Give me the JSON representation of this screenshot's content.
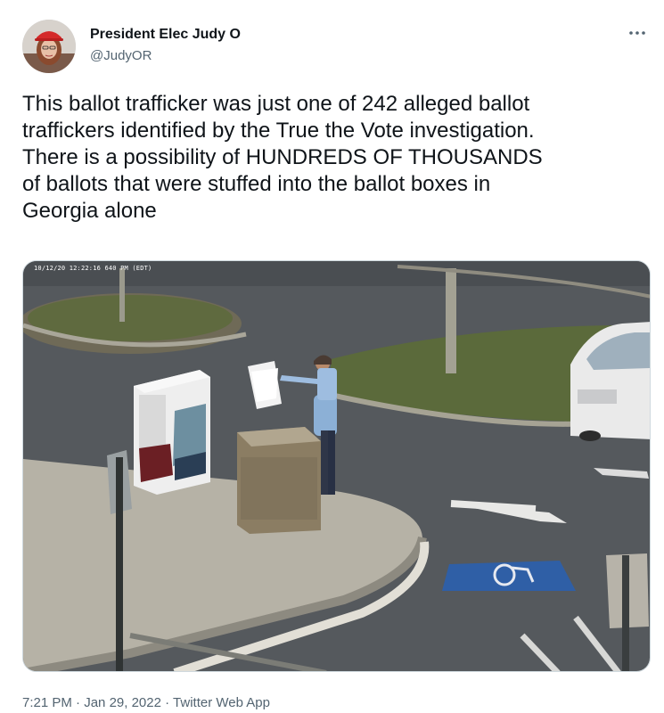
{
  "author": {
    "name": "President Elec Judy O",
    "handle": "@JudyOR"
  },
  "icons": {
    "more": "more-horizontal-icon",
    "avatar": "avatar-photo"
  },
  "tweet": {
    "lines": [
      "This ballot trafficker was just one of 242 alleged ballot",
      "traffickers identified by the True the Vote investigation.",
      "There is a possibility of HUNDREDS OF THOUSANDS",
      "of ballots that were stuffed into the ballot boxes in",
      "Georgia alone"
    ]
  },
  "media": {
    "timestamp": "10/12/20 12:22:16 640 PM (EDT)"
  },
  "meta": {
    "time": "7:21 PM",
    "separator1": " · ",
    "date": "Jan 29, 2022",
    "separator2": " · ",
    "source": "Twitter Web App"
  },
  "colors": {
    "text": "#0f1419",
    "secondary": "#536471",
    "border": "#cfd9de"
  }
}
